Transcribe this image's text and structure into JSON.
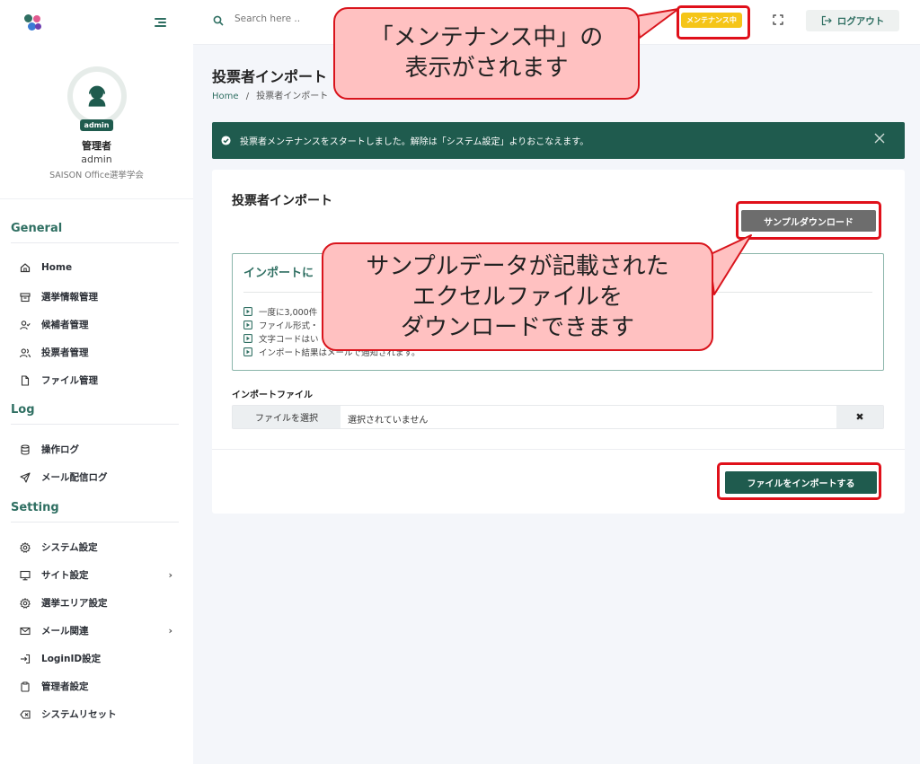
{
  "topbar": {
    "search_placeholder": "Search here ..",
    "maintenance_badge": "メンテナンス中",
    "logout_label": "ログアウト"
  },
  "profile": {
    "avatar_badge": "admin",
    "name": "管理者",
    "role": "admin",
    "org": "SAISON Office選挙学会"
  },
  "sidebar": {
    "general_title": "General",
    "general_items": [
      "Home",
      "選挙情報管理",
      "候補者管理",
      "投票者管理",
      "ファイル管理"
    ],
    "log_title": "Log",
    "log_items": [
      "操作ログ",
      "メール配信ログ"
    ],
    "setting_title": "Setting",
    "setting_items": [
      "システム設定",
      "サイト設定",
      "選挙エリア設定",
      "メール関連",
      "LoginID設定",
      "管理者設定",
      "システムリセット"
    ]
  },
  "page": {
    "title": "投票者インポート",
    "breadcrumb_home": "Home",
    "breadcrumb_sep": "/",
    "breadcrumb_current": "投票者インポート"
  },
  "alert": {
    "message": "投票者メンテナンスをスタートしました。解除は「システム設定」よりおこなえます。"
  },
  "card": {
    "title": "投票者インポート",
    "sample_button": "サンプルダウンロード",
    "info_title": "インポートに",
    "info_items": [
      "一度に3,000件",
      "ファイル形式・",
      "文字コードはい",
      "インポート結果はメールで通知されます。"
    ],
    "file_label": "インポートファイル",
    "file_button": "ファイルを選択",
    "file_status": "選択されていません",
    "clear_button": "✖",
    "import_button": "ファイルをインポートする"
  },
  "callouts": {
    "maintenance_line1": "「メンテナンス中」の",
    "maintenance_line2": "表示がされます",
    "sample_line1": "サンプルデータが記載された",
    "sample_line2": "エクセルファイルを",
    "sample_line3": "ダウンロードできます"
  },
  "colors": {
    "brand": "#1f5b4e",
    "accent": "#2f6f62",
    "badge": "#f5c518",
    "highlight": "#e0101a",
    "callout_bg": "#ffc1c1"
  }
}
